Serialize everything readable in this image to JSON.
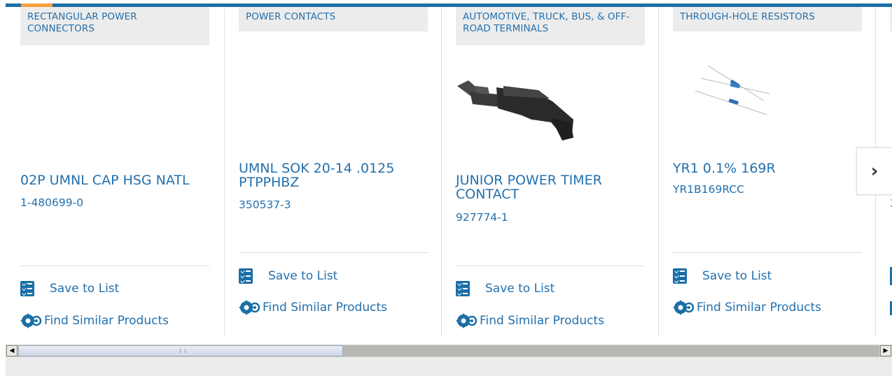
{
  "products": [
    {
      "category": "RECTANGULAR POWER CONNECTORS",
      "title": "02P UMNL CAP HSG NATL",
      "part_number": "1-480699-0",
      "has_image": false,
      "save_label": "Save to List",
      "similar_label": "Find Similar Products"
    },
    {
      "category": "POWER CONTACTS",
      "title": "UMNL SOK 20-14 .0125 PTPPHBZ",
      "part_number": "350537-3",
      "has_image": false,
      "save_label": "Save to List",
      "similar_label": "Find Similar Products"
    },
    {
      "category": "AUTOMOTIVE, TRUCK, BUS, & OFF-ROAD TERMINALS",
      "title": "JUNIOR POWER TIMER CONTACT",
      "part_number": "927774-1",
      "has_image": true,
      "image_icon": "terminal-contact-image",
      "save_label": "Save to List",
      "similar_label": "Find Similar Products"
    },
    {
      "category": "THROUGH-HOLE RESISTORS",
      "title": "YR1 0.1% 169R",
      "part_number": "YR1B169RCC",
      "has_image": true,
      "image_icon": "resistor-image",
      "save_label": "Save to List",
      "similar_label": "Find Similar Products"
    }
  ],
  "partial_card": {
    "part_number_fragment": "3"
  },
  "carousel": {
    "next_glyph": "›"
  },
  "scrollbar": {
    "left_arrow": "◀",
    "right_arrow": "▶"
  },
  "colors": {
    "link": "#2370ad",
    "accent_bar": "#1a6fa6",
    "accent_orange": "#f2a03d",
    "category_bg": "#ececec"
  }
}
